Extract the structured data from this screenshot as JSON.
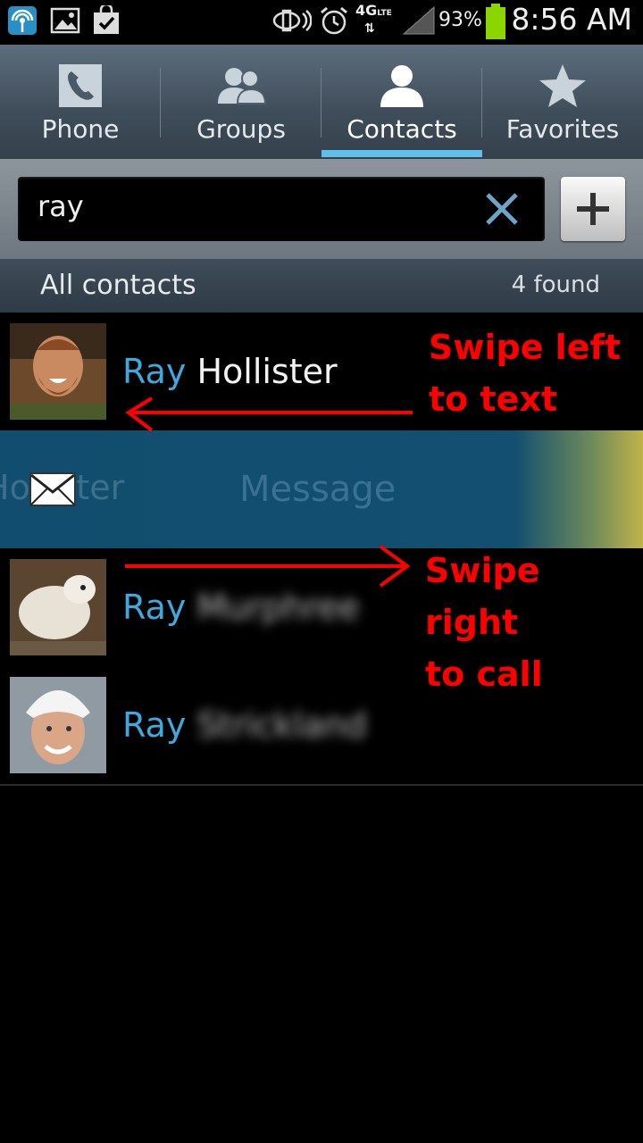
{
  "status_bar": {
    "time": "8:56 AM",
    "battery_percent": "93%",
    "network": "4G",
    "network_sub": "LTE",
    "icons": [
      "wifi-hotspot-icon",
      "gallery-icon",
      "shopping-bag-icon",
      "rotate-icon",
      "alarm-icon",
      "signal-icon",
      "battery-icon"
    ]
  },
  "tabs": [
    {
      "label": "Phone",
      "icon": "phone-icon"
    },
    {
      "label": "Groups",
      "icon": "groups-icon"
    },
    {
      "label": "Contacts",
      "icon": "contact-icon",
      "selected": true
    },
    {
      "label": "Favorites",
      "icon": "star-icon"
    }
  ],
  "search": {
    "value": "ray"
  },
  "section": {
    "title": "All contacts",
    "count": "4 found"
  },
  "contacts": [
    {
      "first": "Ray",
      "last": "Hollister"
    },
    {
      "first": "Ray",
      "last": "Murphree"
    },
    {
      "first": "Ray",
      "last": "Strickland"
    }
  ],
  "swipe_strip": {
    "name_fragment": "Hollister",
    "action_label": "Message"
  },
  "annotations": {
    "swipe_left_line1": "Swipe left",
    "swipe_left_line2": "to text",
    "swipe_right_line1": "Swipe right",
    "swipe_right_line2": "to call"
  },
  "colors": {
    "accent": "#3ea9df",
    "tab_indicator": "#5fc0ea",
    "annotation": "#ff0000",
    "swipe_bg": "#124f70"
  }
}
